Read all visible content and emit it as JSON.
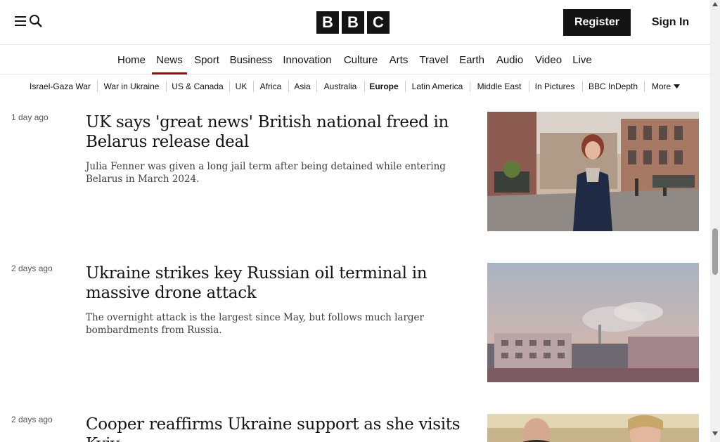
{
  "header": {
    "menu_icon": "menu-icon",
    "search_icon": "search-icon",
    "logo_letters": [
      "B",
      "B",
      "C"
    ],
    "register_label": "Register",
    "signin_label": "Sign In"
  },
  "primary_nav": {
    "items": [
      "Home",
      "News",
      "Sport",
      "Business",
      "Innovation",
      "Culture",
      "Arts",
      "Travel",
      "Earth",
      "Audio",
      "Video",
      "Live"
    ],
    "active": "News"
  },
  "secondary_nav": {
    "items": [
      "Israel-Gaza War",
      "War in Ukraine",
      "US & Canada",
      "UK",
      "Africa",
      "Asia",
      "Australia",
      "Europe",
      "Latin America",
      "Middle East",
      "In Pictures",
      "BBC InDepth",
      "More"
    ],
    "active": "Europe",
    "more_icon": "caret-down-icon"
  },
  "articles": [
    {
      "timestamp": "1 day ago",
      "headline": "UK says 'great news' British national freed in Belarus release deal",
      "summary": "Julia Fenner was given a long jail term after being detained while entering Belarus in March 2024."
    },
    {
      "timestamp": "2 days ago",
      "headline": "Ukraine strikes key Russian oil terminal in massive drone attack",
      "summary": "The overnight attack is the largest since May, but follows much larger bombardments from Russia."
    },
    {
      "timestamp": "2 days ago",
      "headline": "Cooper reaffirms Ukraine support as she visits Kyiv"
    }
  ],
  "colors": {
    "accent": "#b80000",
    "text": "#141414",
    "muted": "#545658"
  }
}
